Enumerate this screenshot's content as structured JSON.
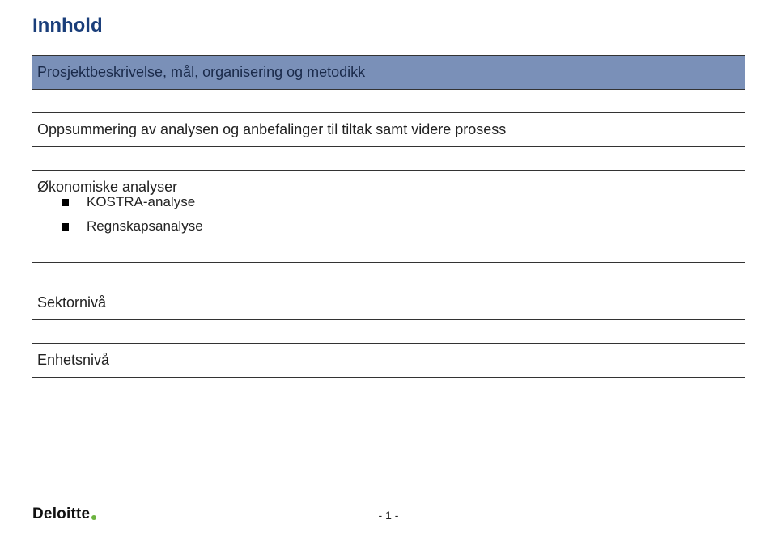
{
  "title": "Innhold",
  "sections": [
    {
      "label": "Prosjektbeskrivelse, mål, organisering og metodikk",
      "highlight": true
    },
    {
      "label": "Oppsummering av analysen og anbefalinger til tiltak samt videre prosess",
      "highlight": false
    },
    {
      "label": "Økonomiske analyser",
      "highlight": false
    },
    {
      "label": "Sektornivå",
      "highlight": false
    },
    {
      "label": "Enhetsnivå",
      "highlight": false
    }
  ],
  "subitems": {
    "analyser": [
      {
        "label": "KOSTRA-analyse"
      },
      {
        "label": "Regnskapsanalyse"
      }
    ]
  },
  "footer": {
    "logo": "Deloitte",
    "page_number": "- 1 -"
  }
}
